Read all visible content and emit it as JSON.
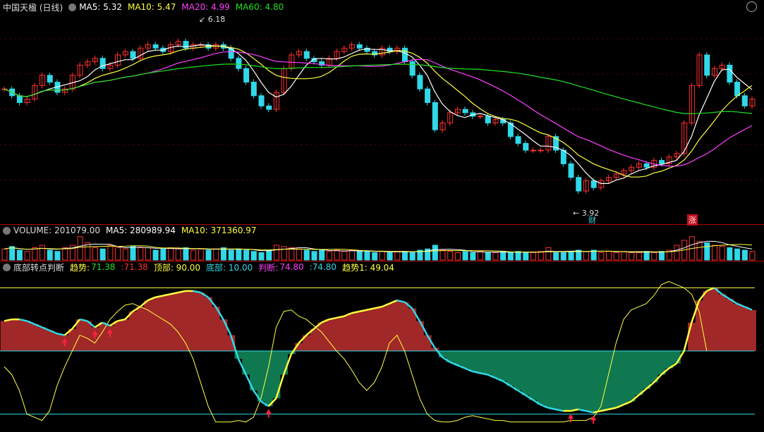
{
  "colors": {
    "up": "#ff3030",
    "down": "#30d8e8",
    "ma5": "#ffffff",
    "ma10": "#ffff40",
    "ma20": "#ff40ff",
    "ma60": "#20e020",
    "bg": "#000000",
    "grid": "#aa0000"
  },
  "header": {
    "main": {
      "title": "中国天楹 (日线)",
      "ma5": "MA5: 5.32",
      "ma10": "MA10: 5.47",
      "ma20": "MA20: 4.99",
      "ma60": "MA60: 4.80"
    },
    "volume": {
      "title": "VOLUME: 201079.00",
      "ma5": "MA5: 280989.94",
      "ma10": "MA10: 371360.97"
    },
    "indicator": {
      "title": "底部转点判断",
      "trend_label": "趋势:",
      "trend_value": "71.38",
      "trend_value2": ":71.38",
      "top": "顶部: 90.00",
      "bottom": "底部: 10.00",
      "judge_label": "判断:",
      "judge_value": "74.80",
      "judge_value2": ":74.80",
      "trend1": "趋势1: 49.04"
    }
  },
  "annotations": {
    "high": "6.18",
    "low": "3.92",
    "mark_cai": "财",
    "mark_zhang": "涨"
  },
  "chart_data": [
    {
      "type": "candlestick",
      "title": "中国天楹 (日线)",
      "ylim": [
        3.6,
        6.5
      ],
      "series": [
        {
          "name": "MA5",
          "current": 5.32
        },
        {
          "name": "MA10",
          "current": 5.47
        },
        {
          "name": "MA20",
          "current": 4.99
        },
        {
          "name": "MA60",
          "current": 4.8
        }
      ],
      "close": [
        5.4,
        5.3,
        5.2,
        5.25,
        5.45,
        5.6,
        5.5,
        5.35,
        5.4,
        5.6,
        5.75,
        5.8,
        5.85,
        5.7,
        5.75,
        5.9,
        5.95,
        5.85,
        6.0,
        6.05,
        6.0,
        5.95,
        6.05,
        6.1,
        6.0,
        6.05,
        6.05,
        6.0,
        6.05,
        6.0,
        5.85,
        5.7,
        5.5,
        5.3,
        5.15,
        5.1,
        5.35,
        5.7,
        5.9,
        5.95,
        5.85,
        5.8,
        5.75,
        5.85,
        5.95,
        6.0,
        6.05,
        6.0,
        5.95,
        5.9,
        6.0,
        5.95,
        6.0,
        5.8,
        5.6,
        5.4,
        5.2,
        4.8,
        4.9,
        5.05,
        5.1,
        5.05,
        5.0,
        5.0,
        4.9,
        4.95,
        4.9,
        4.7,
        4.6,
        4.5,
        4.5,
        4.5,
        4.7,
        4.5,
        4.3,
        4.1,
        3.9,
        4.05,
        3.95,
        4.05,
        4.1,
        4.15,
        4.2,
        4.25,
        4.3,
        4.25,
        4.35,
        4.3,
        4.4,
        4.45,
        4.9,
        5.45,
        5.9,
        5.6,
        5.7,
        5.75,
        5.5,
        5.3,
        5.15,
        5.25
      ],
      "high_label": 6.18,
      "low_label": 3.92
    },
    {
      "type": "bar",
      "title": "VOLUME",
      "series": [
        {
          "name": "VOLUME",
          "current": 201079.0
        },
        {
          "name": "MA5",
          "current": 280989.94
        },
        {
          "name": "MA10",
          "current": 371360.97
        }
      ],
      "values": [
        0.45,
        0.55,
        0.4,
        0.35,
        0.5,
        0.6,
        0.4,
        0.35,
        0.5,
        0.6,
        0.95,
        0.7,
        0.5,
        0.45,
        0.6,
        0.5,
        0.45,
        0.55,
        0.5,
        0.5,
        0.4,
        0.45,
        0.5,
        0.45,
        0.5,
        0.4,
        0.45,
        0.4,
        0.45,
        0.5,
        0.4,
        0.45,
        0.4,
        0.35,
        0.3,
        0.4,
        0.6,
        0.55,
        0.5,
        0.45,
        0.4,
        0.35,
        0.4,
        0.35,
        0.4,
        0.35,
        0.4,
        0.35,
        0.35,
        0.3,
        0.35,
        0.3,
        0.35,
        0.35,
        0.3,
        0.4,
        0.45,
        0.6,
        0.4,
        0.35,
        0.3,
        0.35,
        0.3,
        0.35,
        0.3,
        0.3,
        0.35,
        0.3,
        0.35,
        0.3,
        0.3,
        0.35,
        0.5,
        0.3,
        0.3,
        0.35,
        0.4,
        0.35,
        0.4,
        0.3,
        0.35,
        0.3,
        0.35,
        0.3,
        0.3,
        0.35,
        0.3,
        0.35,
        0.4,
        0.6,
        0.8,
        0.95,
        0.75,
        0.7,
        0.6,
        0.55,
        0.5,
        0.45,
        0.4,
        0.35
      ]
    },
    {
      "type": "area",
      "title": "底部转点判断",
      "ylim": [
        0,
        100
      ],
      "reference_lines": [
        {
          "name": "顶部",
          "value": 90
        },
        {
          "name": "底部",
          "value": 10
        },
        {
          "name": "中轴",
          "value": 50
        }
      ],
      "series": [
        {
          "name": "趋势",
          "current": 71.38,
          "values": [
            69,
            70,
            70,
            69,
            67,
            65,
            63,
            61,
            60,
            64,
            70,
            69,
            65,
            68,
            66,
            69,
            70,
            75,
            78,
            82,
            84,
            85,
            86,
            87,
            88,
            88,
            87,
            84,
            78,
            70,
            60,
            45,
            35,
            25,
            18,
            15,
            20,
            35,
            48,
            55,
            60,
            64,
            68,
            70,
            71,
            72,
            74,
            75,
            76,
            77,
            78,
            80,
            82,
            81,
            77,
            69,
            60,
            52,
            46,
            43,
            41,
            39,
            37,
            36,
            35,
            33,
            31,
            28,
            25,
            22,
            19,
            16,
            14,
            13,
            12,
            12,
            13,
            12,
            11,
            12,
            13,
            14,
            16,
            18,
            22,
            26,
            30,
            35,
            39,
            42,
            50,
            68,
            82,
            88,
            90,
            86,
            83,
            80,
            78,
            76
          ]
        },
        {
          "name": "判断",
          "current": 74.8,
          "values": [
            40,
            35,
            25,
            10,
            8,
            6,
            12,
            28,
            40,
            50,
            60,
            58,
            55,
            62,
            70,
            75,
            79,
            80,
            78,
            76,
            73,
            70,
            67,
            62,
            55,
            45,
            30,
            15,
            5,
            5,
            5,
            6,
            5,
            8,
            20,
            40,
            65,
            75,
            76,
            72,
            70,
            66,
            62,
            56,
            50,
            45,
            38,
            30,
            25,
            30,
            40,
            55,
            60,
            50,
            35,
            20,
            10,
            6,
            5,
            5,
            6,
            8,
            9,
            8,
            7,
            6,
            6,
            5,
            5,
            5,
            5,
            5,
            5,
            5,
            5,
            6,
            6,
            6,
            8,
            15,
            35,
            55,
            70,
            76,
            78,
            80,
            85,
            92,
            94,
            92,
            90,
            86,
            75,
            50
          ]
        },
        {
          "name": "趋势1",
          "current": 49.04
        }
      ]
    }
  ]
}
